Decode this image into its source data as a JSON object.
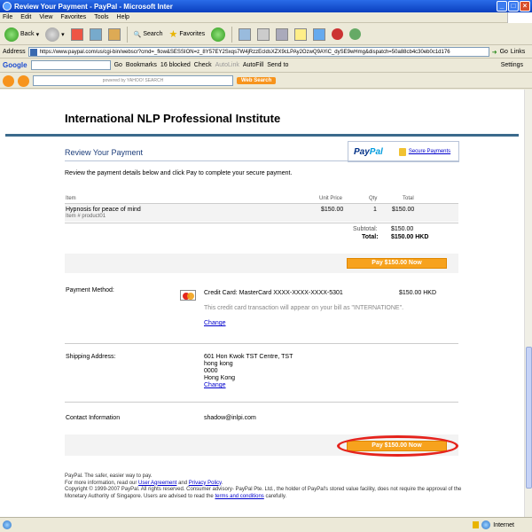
{
  "window": {
    "title": "Review Your Payment - PayPal - Microsoft Inter"
  },
  "menu": [
    "File",
    "Edit",
    "View",
    "Favorites",
    "Tools",
    "Help"
  ],
  "toolbar": {
    "back": "Back",
    "search": "Search",
    "favorites": "Favorites"
  },
  "address": {
    "label": "Address",
    "url": "https://www.paypal.com/us/cgi-bin/webscr?cmd=_flow&SESSION=z_8Y57EY2Sxqs7W4jRzzEcldsXZX9cLPAy2OzwQ9AYiC_dySE9wHmg&dispatch=50a88cb4c30eb0c1d176",
    "go": "Go",
    "links": "Links"
  },
  "googlebar": {
    "logo": "Google",
    "go": "Go",
    "bookmarks": "Bookmarks",
    "blocked": "16 blocked",
    "check": "Check",
    "autolink": "AutoLink",
    "autofill": "AutoFill",
    "sendto": "Send to",
    "settings": "Settings"
  },
  "yahoobar": {
    "search_placeholder": "powered by YAHOO! SEARCH",
    "web_search": "Web Search"
  },
  "page": {
    "site_title": "International NLP Professional Institute",
    "section_title": "Review Your Payment",
    "paypal_logo_a": "Pay",
    "paypal_logo_b": "Pal",
    "secure_payments": "Secure Payments",
    "intro": "Review the payment details below and click Pay to complete your secure payment.",
    "cart": {
      "headers": {
        "item": "Item",
        "unit_price": "Unit Price",
        "qty": "Qty",
        "total": "Total"
      },
      "item_name": "Hypnosis for peace of mind",
      "item_number": "Item # product01",
      "unit_price": "$150.00",
      "qty": "1",
      "total": "$150.00",
      "subtotal_label": "Subtotal:",
      "subtotal": "$150.00",
      "total_label": "Total:",
      "grand_total": "$150.00  HKD"
    },
    "pay_button": "Pay $150.00 Now",
    "payment_method": {
      "label": "Payment Method:",
      "card": "Credit Card: MasterCard XXXX-XXXX-XXXX-5301",
      "amount": "$150.00 HKD",
      "note": "This credit card transaction will appear on your bill as \"INTERNATIONE\".",
      "change": "Change"
    },
    "shipping": {
      "label": "Shipping Address:",
      "line1": "601 Hon Kwok TST Centre, TST",
      "line2": "hong kong",
      "line3": "0000",
      "line4": "Hong Kong",
      "change": "Change"
    },
    "contact": {
      "label": "Contact Information",
      "email": "shadow@inlpi.com"
    },
    "footer": {
      "line1": "PayPal. The safer, easier way to pay.",
      "line2_a": "For more information, read our ",
      "user_agreement": "User Agreement",
      "and": " and ",
      "privacy_policy": "Privacy Policy",
      "line3": "Copyright © 1999-2007 PayPal. All rights reserved. Consumer advisory- PayPal Pte. Ltd., the holder of PayPal's stored value facility, does not require the approval of the Monetary Authority of Singapore. Users are advised to read the ",
      "terms": "terms and conditions",
      "line3_end": " carefully."
    }
  },
  "status": {
    "zone": "Internet"
  },
  "colors": {
    "accent": "#1c3d7a",
    "pay_button": "#f7a21d",
    "highlight_ring": "#e5231c",
    "rule": "#3b6a8c"
  }
}
